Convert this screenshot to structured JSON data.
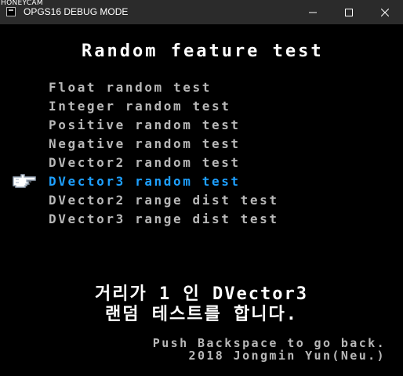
{
  "window": {
    "watermark": "HONEYCAM",
    "title": "OPGS16 DEBUG MODE",
    "controls": {
      "minimize_icon": "minimize-icon",
      "maximize_icon": "maximize-icon",
      "close_icon": "close-icon"
    }
  },
  "screen": {
    "heading": "Random feature test",
    "menu": [
      "Float random test",
      "Integer random test",
      "Positive random test",
      "Negative random test",
      "DVector2 random test",
      "DVector3 random test",
      "DVector2 range dist test",
      "DVector3 range dist test"
    ],
    "selected_index": 5,
    "cursor_icon": "pointing-hand-icon",
    "description": {
      "line1": "거리가 1 인 DVector3",
      "line2": "랜덤 테스트를 합니다."
    },
    "footer": {
      "line1": "Push Backspace to go back.",
      "line2": "2018 Jongmin Yun(Neu.)"
    }
  },
  "colors": {
    "background": "#000000",
    "menu_text": "#b8b8b8",
    "selected_text": "#1ea0ff",
    "heading_text": "#ffffff",
    "titlebar": "#2b2b2b"
  }
}
